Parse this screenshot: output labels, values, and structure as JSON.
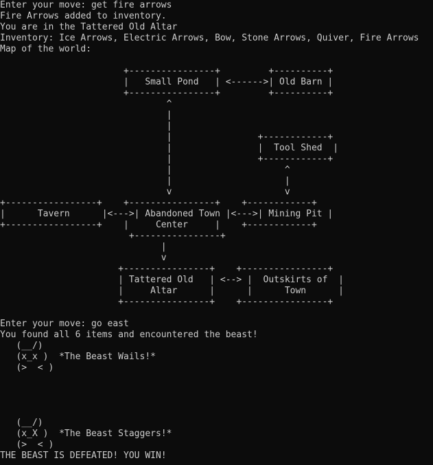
{
  "colors": {
    "background": "#0c0c0c",
    "foreground": "#cccccc"
  },
  "console": {
    "lines": [
      "Enter your move: get fire arrows",
      "Fire Arrows added to inventory.",
      "You are in the Tattered Old Altar",
      "Inventory: Ice Arrows, Electric Arrows, Bow, Stone Arrows, Quiver, Fire Arrows",
      "Map of the world:",
      "",
      "                       +----------------+         +----------+",
      "                       |   Small Pond   | <------>| Old Barn |",
      "                       +----------------+         +----------+",
      "                               ^",
      "                               |",
      "                               |",
      "                               |                +------------+",
      "                               |                |  Tool Shed  |",
      "                               |                +------------+",
      "                               |                     ^",
      "                               |                     |",
      "                               v                     v",
      "+-----------------+    +----------------+    +------------+",
      "|      Tavern      |<--->| Abandoned Town |<--->| Mining Pit |",
      "+-----------------+    |     Center     |    +------------+",
      "                        +----------------+",
      "                              |",
      "                              v",
      "                      +----------------+    +----------------+",
      "                      | Tattered Old   | <--> |  Outskirts of  |",
      "                      |     Altar      |      |      Town      |",
      "                      +----------------+    +----------------+",
      "",
      "Enter your move: go east",
      "You found all 6 items and encountered the beast!",
      "   (__/)",
      "   (x_x )  *The Beast Wails!*",
      "   (>  < )",
      "",
      "",
      "",
      "",
      "   (__/)",
      "   (x_X )  *The Beast Staggers!*",
      "   (>  < )",
      "THE BEAST IS DEFEATED! YOU WIN!"
    ]
  }
}
